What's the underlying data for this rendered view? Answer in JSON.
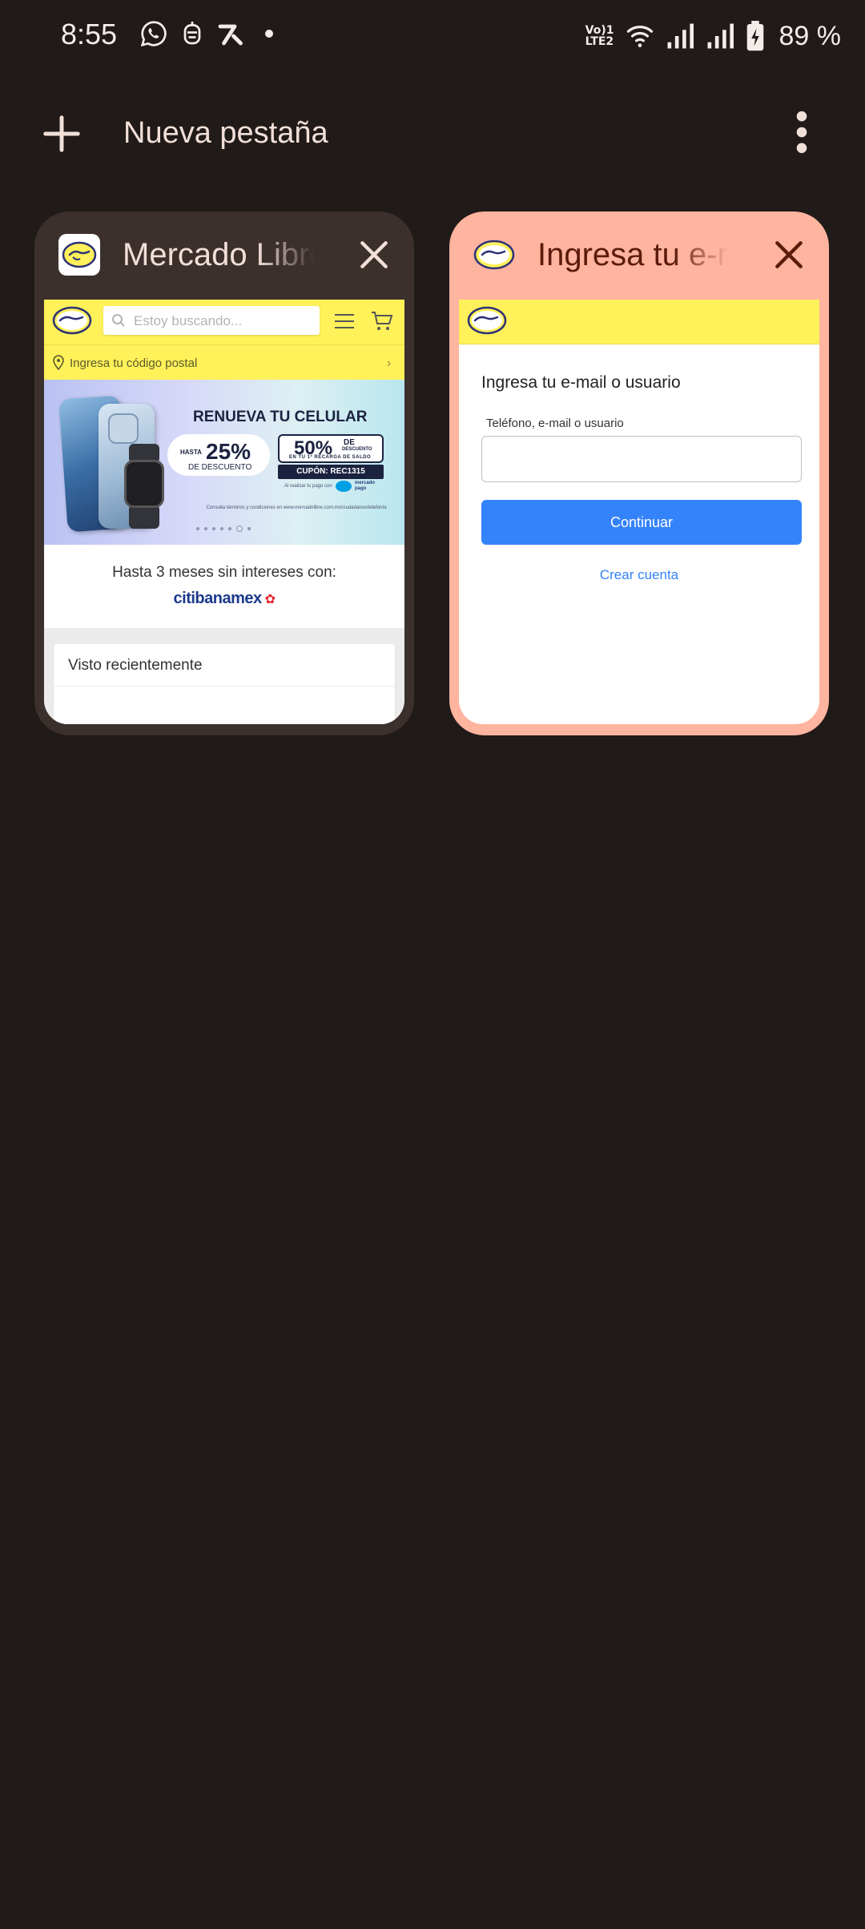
{
  "status_bar": {
    "time": "8:55",
    "battery_percent": "89 %",
    "network_label": "Vo) 1\nLTE2"
  },
  "toolbar": {
    "new_tab_label": "Nueva pestaña"
  },
  "tabs": [
    {
      "title": "Mercado Libre",
      "active": false,
      "thumbnail": {
        "search_placeholder": "Estoy buscando...",
        "postal_prompt": "Ingresa tu código postal",
        "banner": {
          "headline": "RENUEVA TU CELULAR",
          "hasta": "HASTA",
          "discount_value": "25%",
          "discount_label": "DE DESCUENTO",
          "second_value": "50%",
          "second_de": "DE",
          "second_small": "DESCUENTO",
          "second_recarga": "EN TU 1ª RECARGA DE SALDO",
          "coupon": "CUPÓN: REC1315",
          "pay_note": "Al realizar tu pago con",
          "mp_text": "mercado\npago",
          "terms": "Consulta términos y condiciones en www.mercadolibre.com.mx/ciudadanos/telefonía"
        },
        "installments_text": "Hasta 3 meses sin intereses con:",
        "bank_name": "citibanamex",
        "recent_title": "Visto recientemente"
      }
    },
    {
      "title": "Ingresa tu e-mail",
      "active": true,
      "thumbnail": {
        "heading": "Ingresa tu e-mail o usuario",
        "field_label": "Teléfono, e-mail o usuario",
        "field_value": "",
        "continue_label": "Continuar",
        "create_account_label": "Crear cuenta"
      }
    }
  ],
  "colors": {
    "background": "#201a18",
    "inactive_card": "#3c302d",
    "active_card": "#ffb49f",
    "ml_yellow": "#fff159",
    "ml_blue": "#3483fa"
  }
}
